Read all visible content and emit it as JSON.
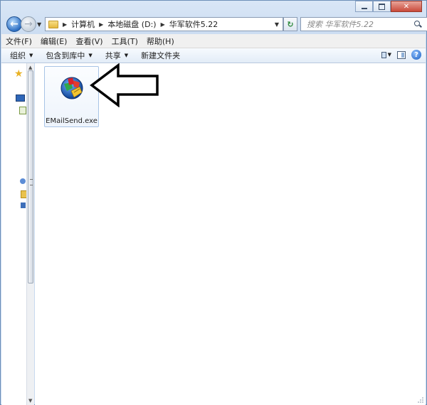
{
  "window": {
    "controls": [
      "minimize",
      "maximize",
      "close"
    ],
    "close_symbol": "✕"
  },
  "nav": {
    "back_symbol": "←",
    "forward_symbol": "→",
    "breadcrumb": [
      "计算机",
      "本地磁盘 (D:)",
      "华军软件5.22"
    ],
    "refresh_symbol": "↻",
    "search_placeholder": "搜索 华军软件5.22"
  },
  "menubar": {
    "items": [
      "文件(F)",
      "编辑(E)",
      "查看(V)",
      "工具(T)",
      "帮助(H)"
    ]
  },
  "commandbar": {
    "organize": "组织",
    "include_in_library": "包含到库中",
    "share": "共享",
    "new_folder": "新建文件夹",
    "help_symbol": "?"
  },
  "content": {
    "files": [
      {
        "name": "EMailSend.exe",
        "icon": "emailsend-app-icon",
        "selected": true
      }
    ],
    "annotation": "arrow-pointing-at-file"
  },
  "colors": {
    "accent": "#2d6fc3",
    "selection_border": "#a8c4e6",
    "star": "#e9b225"
  }
}
